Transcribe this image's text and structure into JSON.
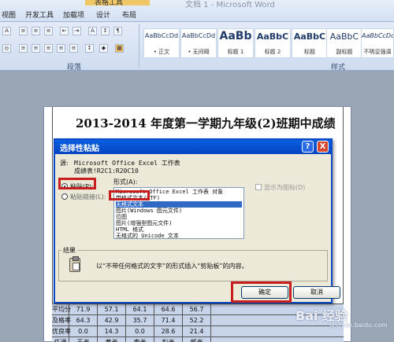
{
  "window": {
    "title": "文档 1 - Microsoft Word",
    "context_tab_group": "表格工具"
  },
  "ribbon": {
    "tabs": [
      "视图",
      "开发工具",
      "加载项",
      "设计",
      "布局"
    ],
    "groups": {
      "paragraph": "段落",
      "styles": "样式"
    },
    "styles": [
      {
        "sample": "AaBbCcDd",
        "name": "• 正文"
      },
      {
        "sample": "AaBbCcDd",
        "name": "• 无间隔"
      },
      {
        "sample": "AaBb",
        "name": "标题 1"
      },
      {
        "sample": "AaBbC",
        "name": "标题 2"
      },
      {
        "sample": "AaBbC",
        "name": "标题"
      },
      {
        "sample": "AaBbC",
        "name": "副标题"
      },
      {
        "sample": "AaBbCcDd",
        "name": "不明显强调"
      }
    ]
  },
  "document": {
    "title": "2013-2014 年度第一学期九年级(2)班期中成绩",
    "rows": [
      {
        "label": "平均分",
        "values": [
          "71.9",
          "57.1",
          "64.1",
          "64.6",
          "56.7"
        ]
      },
      {
        "label": "及格率",
        "values": [
          "64.3",
          "42.9",
          "35.7",
          "71.4",
          "52.2"
        ]
      },
      {
        "label": "优良率",
        "values": [
          "0.0",
          "14.3",
          "0.0",
          "28.6",
          "21.4"
        ]
      },
      {
        "label": "任课",
        "values": [
          "王老",
          "黄老",
          "李老",
          "彭老",
          "郭老"
        ]
      }
    ]
  },
  "dialog": {
    "title": "选择性粘贴",
    "help": "?",
    "close": "X",
    "source_label": "源:",
    "source_value": "Microsoft Office Excel 工作表",
    "source_range": "成绩表!R2C1:R20C10",
    "form_label": "形式(A):",
    "paste_label": "粘贴(P):",
    "paste_link_label": "粘贴链接(L):",
    "options": [
      "Microsoft Office Excel 工作表 对象",
      "带格式文本(RTF)",
      "无格式文本",
      "图片(Windows 图元文件)",
      "位图",
      "图片(增强型图元文件)",
      "HTML 格式",
      "无格式的 Unicode 文本"
    ],
    "display_as_icon": "显示为图标(D)",
    "result_label": "结果",
    "result_text": "以“不带任何格式的文字”的形式插入“剪贴板”的内容。",
    "ok": "确定",
    "cancel": "取消"
  },
  "watermark": {
    "main": "Bai 经验",
    "sub": "jingyan.baidu.com"
  }
}
